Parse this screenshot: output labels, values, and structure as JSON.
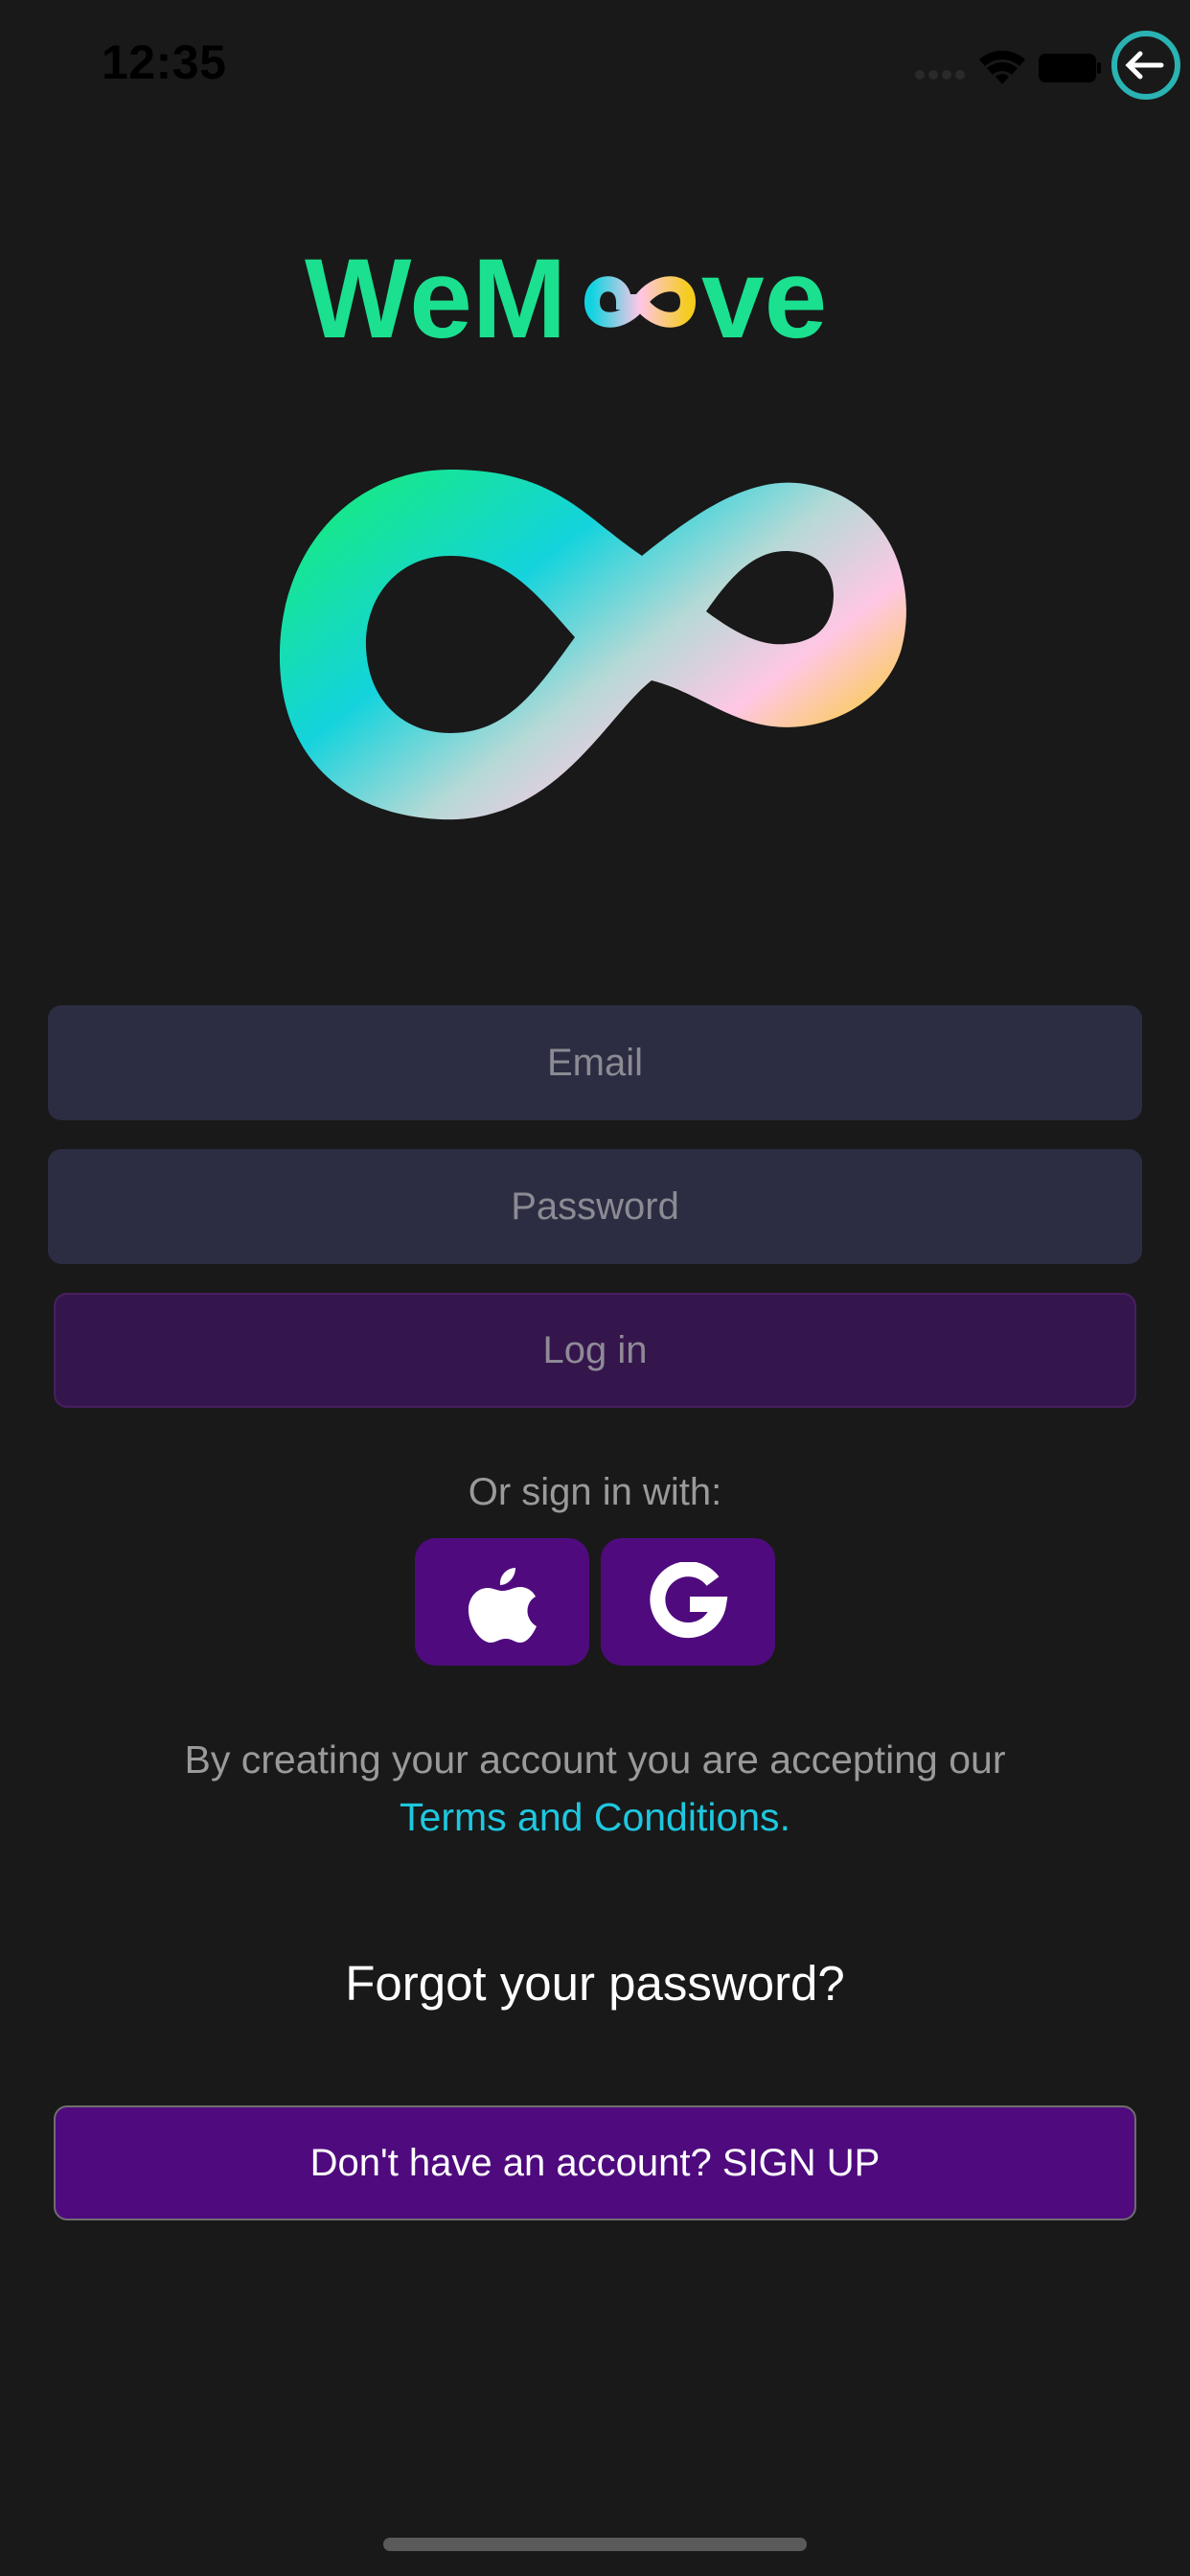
{
  "status_bar": {
    "time": "12:35",
    "icons": [
      "signal-icon",
      "wifi-icon",
      "battery-icon",
      "accessibility-icon"
    ]
  },
  "brand": {
    "wordmark_before": "WeM",
    "wordmark_after": "ve",
    "colors": {
      "green": "#1be08f",
      "cyan": "#13d3e0",
      "pink": "#ffc6e6",
      "yellow": "#f5cc1f"
    }
  },
  "form": {
    "email_placeholder": "Email",
    "password_placeholder": "Password",
    "login_label": "Log in"
  },
  "social": {
    "prompt": "Or sign in with:",
    "providers": [
      "apple-icon",
      "google-icon"
    ]
  },
  "terms": {
    "line1": "By creating your account you are accepting our",
    "link": "Terms and Conditions",
    "suffix": "."
  },
  "forgot_label": "Forgot your password?",
  "signup_label": "Don't have an account? SIGN UP",
  "colors": {
    "background": "#191919",
    "input": "#2c2d42",
    "login_button": "#35164c",
    "social_button": "#4f0b7e",
    "link": "#1ec8df"
  }
}
